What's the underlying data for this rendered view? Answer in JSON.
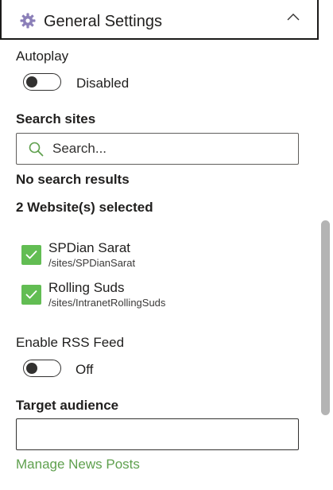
{
  "header": {
    "title": "General Settings",
    "icon": "gear-icon",
    "collapse_icon": "chevron-up-icon"
  },
  "autoplay": {
    "label": "Autoplay",
    "state": "Disabled",
    "enabled": false
  },
  "search": {
    "label": "Search sites",
    "placeholder": "Search...",
    "value": "",
    "no_results": "No search results",
    "selected_count": "2 Website(s) selected"
  },
  "sites": [
    {
      "name": "SPDian Sarat",
      "url": "/sites/SPDianSarat",
      "checked": true
    },
    {
      "name": "Rolling Suds",
      "url": "/sites/IntranetRollingSuds",
      "checked": true
    }
  ],
  "rss": {
    "label": "Enable RSS Feed",
    "state": "Off",
    "enabled": false
  },
  "audience": {
    "label": "Target audience",
    "value": ""
  },
  "manage_link": "Manage News Posts",
  "colors": {
    "accent_green": "#62bd53",
    "link_green": "#5fa04e",
    "text": "#201f1e",
    "border": "#1b1a19"
  }
}
